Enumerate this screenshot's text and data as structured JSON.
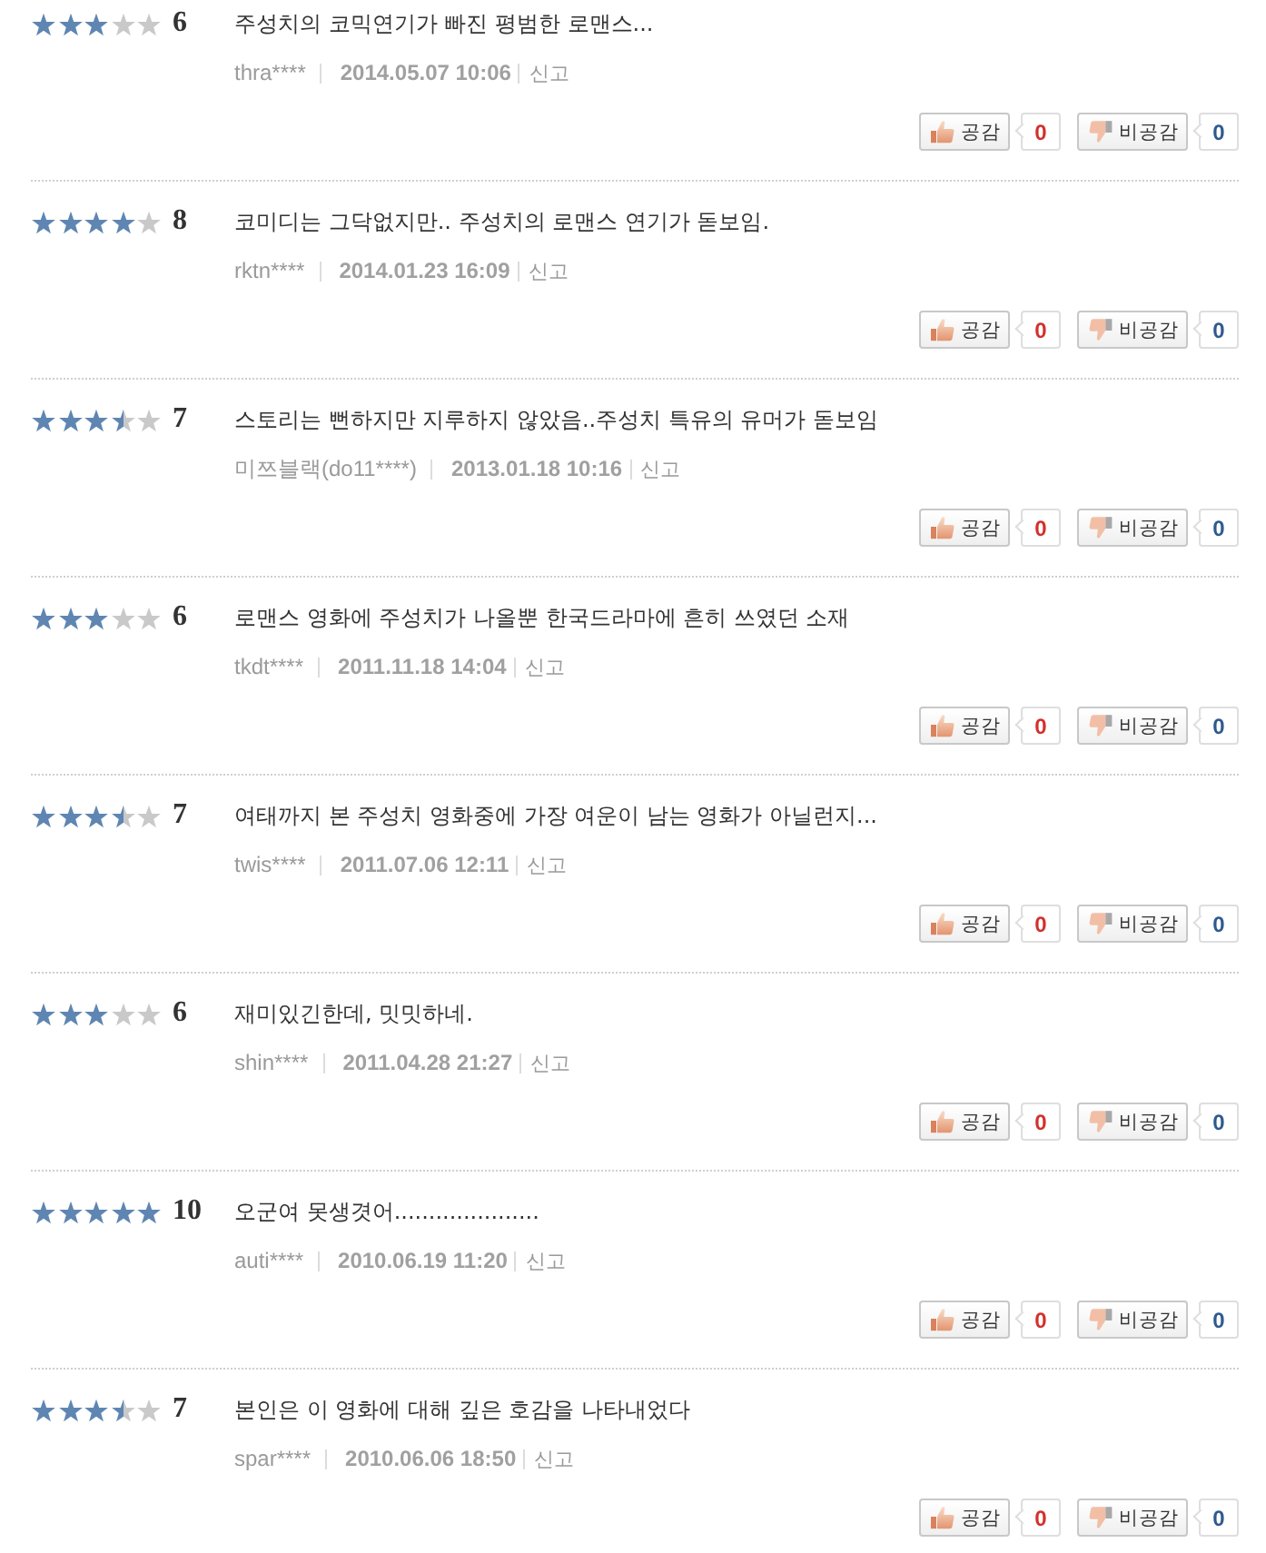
{
  "reviews": [
    {
      "stars": 3,
      "score": "6",
      "text": "주성치의 코믹연기가 빠진 평범한 로맨스...",
      "user": "thra****",
      "date": "2014.05.07 10:06",
      "report": "신고",
      "like": {
        "label": "공감",
        "count": "0"
      },
      "dislike": {
        "label": "비공감",
        "count": "0"
      }
    },
    {
      "stars": 4,
      "score": "8",
      "text": "코미디는 그닥없지만.. 주성치의 로맨스 연기가 돋보임.",
      "user": "rktn****",
      "date": "2014.01.23 16:09",
      "report": "신고",
      "like": {
        "label": "공감",
        "count": "0"
      },
      "dislike": {
        "label": "비공감",
        "count": "0"
      }
    },
    {
      "stars": 3.5,
      "score": "7",
      "text": "스토리는 뻔하지만 지루하지 않았음..주성치 특유의 유머가 돋보임",
      "user": "미쯔블랙(do11****)",
      "date": "2013.01.18 10:16",
      "report": "신고",
      "like": {
        "label": "공감",
        "count": "0"
      },
      "dislike": {
        "label": "비공감",
        "count": "0"
      }
    },
    {
      "stars": 3,
      "score": "6",
      "text": "로맨스 영화에 주성치가 나올뿐 한국드라마에 흔히 쓰였던 소재",
      "user": "tkdt****",
      "date": "2011.11.18 14:04",
      "report": "신고",
      "like": {
        "label": "공감",
        "count": "0"
      },
      "dislike": {
        "label": "비공감",
        "count": "0"
      }
    },
    {
      "stars": 3.5,
      "score": "7",
      "text": "여태까지 본 주성치 영화중에 가장 여운이 남는 영화가 아닐런지...",
      "user": "twis****",
      "date": "2011.07.06 12:11",
      "report": "신고",
      "like": {
        "label": "공감",
        "count": "0"
      },
      "dislike": {
        "label": "비공감",
        "count": "0"
      }
    },
    {
      "stars": 3,
      "score": "6",
      "text": "재미있긴한데, 밋밋하네.",
      "user": "shin****",
      "date": "2011.04.28 21:27",
      "report": "신고",
      "like": {
        "label": "공감",
        "count": "0"
      },
      "dislike": {
        "label": "비공감",
        "count": "0"
      }
    },
    {
      "stars": 5,
      "score": "10",
      "text": "오군여 못생겻어.....................",
      "user": "auti****",
      "date": "2010.06.19 11:20",
      "report": "신고",
      "like": {
        "label": "공감",
        "count": "0"
      },
      "dislike": {
        "label": "비공감",
        "count": "0"
      }
    },
    {
      "stars": 3.5,
      "score": "7",
      "text": "본인은 이 영화에 대해 깊은 호감을 나타내었다",
      "user": "spar****",
      "date": "2010.06.06 18:50",
      "report": "신고",
      "like": {
        "label": "공감",
        "count": "0"
      },
      "dislike": {
        "label": "비공감",
        "count": "0"
      }
    }
  ]
}
